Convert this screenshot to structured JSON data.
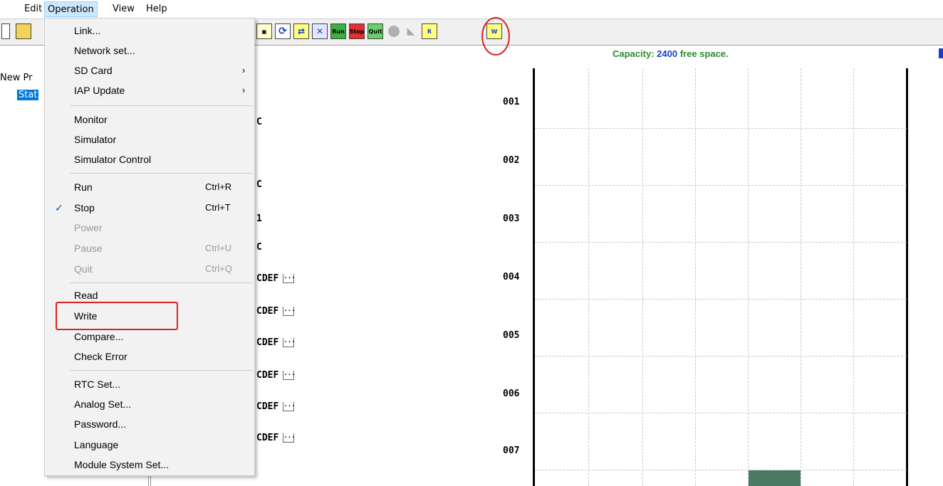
{
  "menubar": {
    "items": [
      "Edit",
      "Operation",
      "View",
      "Help"
    ]
  },
  "tree": {
    "project": "New Pr",
    "station": "Stat"
  },
  "operation_menu": {
    "items": [
      {
        "label": "Link...",
        "shortcut": "",
        "submenu": false,
        "disabled": false,
        "checked": false
      },
      {
        "label": "Network set...",
        "shortcut": "",
        "submenu": false,
        "disabled": false,
        "checked": false
      },
      {
        "label": "SD Card",
        "shortcut": "",
        "submenu": true,
        "disabled": false,
        "checked": false
      },
      {
        "label": "IAP Update",
        "shortcut": "",
        "submenu": true,
        "disabled": false,
        "checked": false
      },
      {
        "label": "Monitor",
        "shortcut": "",
        "submenu": false,
        "disabled": false,
        "checked": false
      },
      {
        "label": "Simulator",
        "shortcut": "",
        "submenu": false,
        "disabled": false,
        "checked": false
      },
      {
        "label": "Simulator Control",
        "shortcut": "",
        "submenu": false,
        "disabled": false,
        "checked": false
      },
      {
        "label": "Run",
        "shortcut": "Ctrl+R",
        "submenu": false,
        "disabled": false,
        "checked": false
      },
      {
        "label": "Stop",
        "shortcut": "Ctrl+T",
        "submenu": false,
        "disabled": false,
        "checked": true
      },
      {
        "label": "Power",
        "shortcut": "",
        "submenu": false,
        "disabled": true,
        "checked": false
      },
      {
        "label": "Pause",
        "shortcut": "Ctrl+U",
        "submenu": false,
        "disabled": true,
        "checked": false
      },
      {
        "label": "Quit",
        "shortcut": "Ctrl+Q",
        "submenu": false,
        "disabled": true,
        "checked": false
      },
      {
        "label": "Read",
        "shortcut": "",
        "submenu": false,
        "disabled": false,
        "checked": false
      },
      {
        "label": "Write",
        "shortcut": "",
        "submenu": false,
        "disabled": false,
        "checked": false
      },
      {
        "label": "Compare...",
        "shortcut": "",
        "submenu": false,
        "disabled": false,
        "checked": false
      },
      {
        "label": "Check Error",
        "shortcut": "",
        "submenu": false,
        "disabled": false,
        "checked": false
      },
      {
        "label": "RTC Set...",
        "shortcut": "",
        "submenu": false,
        "disabled": false,
        "checked": false
      },
      {
        "label": "Analog Set...",
        "shortcut": "",
        "submenu": false,
        "disabled": false,
        "checked": false
      },
      {
        "label": "Password...",
        "shortcut": "",
        "submenu": false,
        "disabled": false,
        "checked": false
      },
      {
        "label": "Language",
        "shortcut": "",
        "submenu": false,
        "disabled": false,
        "checked": false
      },
      {
        "label": "Module System Set...",
        "shortcut": "",
        "submenu": false,
        "disabled": false,
        "checked": false
      }
    ],
    "submenu_arrow": "›",
    "check_mark": "✓"
  },
  "toolbar": {
    "run_label": "Run",
    "stop_label": "Stop",
    "quit_label": "Quit",
    "read_label": "R",
    "write_label": "W"
  },
  "middle_panel": {
    "rows": [
      {
        "text": "C",
        "has_button": false
      },
      {
        "text": "C",
        "has_button": false
      },
      {
        "text": "1",
        "has_button": false
      },
      {
        "text": "C",
        "has_button": false
      },
      {
        "text": "CDEF",
        "has_button": true
      },
      {
        "text": "CDEF",
        "has_button": true
      },
      {
        "text": "CDEF",
        "has_button": true
      },
      {
        "text": "CDEF",
        "has_button": true
      },
      {
        "text": "CDEF",
        "has_button": true
      },
      {
        "text": "CDEF",
        "has_button": true
      }
    ],
    "ellipsis_label": "..."
  },
  "status": {
    "capacity_label": "Capacity:",
    "capacity_value": "2400",
    "capacity_suffix": "free space."
  },
  "ladder": {
    "rows": [
      "001",
      "002",
      "003",
      "004",
      "005",
      "006",
      "007"
    ],
    "cursor_color": "#4a7a63"
  },
  "colors": {
    "highlight_red": "#e02020",
    "menu_active": "#cce8ff",
    "capacity_green": "#2d8a2d",
    "capacity_blue": "#1a3cd0"
  }
}
